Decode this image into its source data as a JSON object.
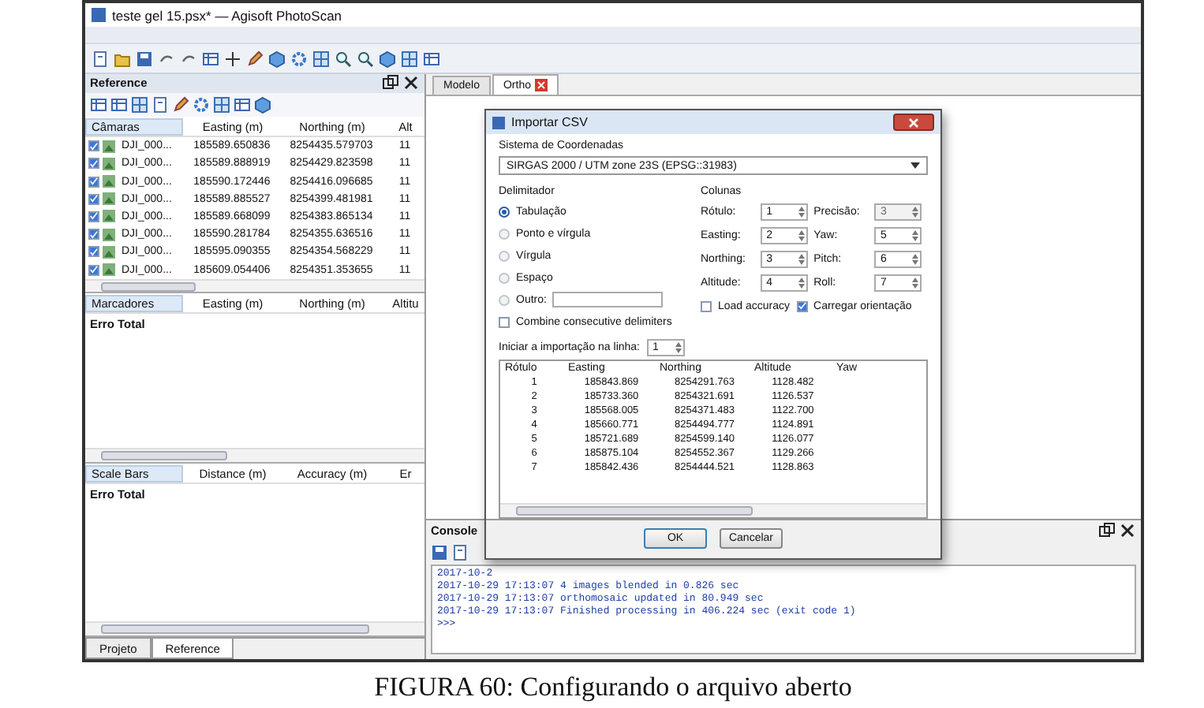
{
  "window": {
    "title": "teste gel 15.psx* — Agisoft PhotoScan"
  },
  "reference_panel": {
    "title": "Reference",
    "cameras": {
      "columns": [
        "Câmaras",
        "Easting (m)",
        "Northing (m)",
        "Alt"
      ],
      "rows": [
        {
          "checked": true,
          "label": "DJI_000...",
          "easting": "185589.650836",
          "northing": "8254435.579703",
          "altitude": "11"
        },
        {
          "checked": true,
          "label": "DJI_000...",
          "easting": "185589.888919",
          "northing": "8254429.823598",
          "altitude": "11"
        },
        {
          "checked": true,
          "label": "DJI_000...",
          "easting": "185590.172446",
          "northing": "8254416.096685",
          "altitude": "11"
        },
        {
          "checked": true,
          "label": "DJI_000...",
          "easting": "185589.885527",
          "northing": "8254399.481981",
          "altitude": "11"
        },
        {
          "checked": true,
          "label": "DJI_000...",
          "easting": "185589.668099",
          "northing": "8254383.865134",
          "altitude": "11"
        },
        {
          "checked": true,
          "label": "DJI_000...",
          "easting": "185590.281784",
          "northing": "8254355.636516",
          "altitude": "11"
        },
        {
          "checked": true,
          "label": "DJI_000...",
          "easting": "185595.090355",
          "northing": "8254354.568229",
          "altitude": "11"
        },
        {
          "checked": true,
          "label": "DJI_000...",
          "easting": "185609.054406",
          "northing": "8254351.353655",
          "altitude": "11"
        }
      ]
    },
    "markers": {
      "columns": [
        "Marcadores",
        "Easting (m)",
        "Northing (m)",
        "Altitu"
      ],
      "total": "Erro Total"
    },
    "scale_bars": {
      "columns": [
        "Scale Bars",
        "Distance (m)",
        "Accuracy (m)",
        "Er"
      ],
      "total": "Erro Total"
    },
    "tabs": [
      {
        "label": "Projeto",
        "selected": false
      },
      {
        "label": "Reference",
        "selected": true
      }
    ]
  },
  "view_tabs": [
    {
      "label": "Modelo",
      "selected": false
    },
    {
      "label": "Ortho",
      "selected": true
    }
  ],
  "console": {
    "title": "Console",
    "lines": [
      "2017-10-2",
      "2017-10-29 17:13:07 4 images blended in 0.826 sec",
      "2017-10-29 17:13:07 orthomosaic updated in 80.949 sec",
      "2017-10-29 17:13:07 Finished processing in 406.224 sec (exit code 1)"
    ],
    "prompt": ">>>"
  },
  "dialog": {
    "title": "Importar CSV",
    "crs_label": "Sistema de Coordenadas",
    "crs_value": "SIRGAS 2000 / UTM zone 23S (EPSG::31983)",
    "delimiter_label": "Delimitador",
    "delimiters": [
      {
        "kind": "option",
        "label": "Tabulação",
        "selected": true
      },
      {
        "kind": "option",
        "label": "Ponto e vírgula",
        "selected": false
      },
      {
        "kind": "option",
        "label": "Vírgula",
        "selected": false
      },
      {
        "kind": "option",
        "label": "Espaço",
        "selected": false
      },
      {
        "kind": "custom",
        "label": "Outro:",
        "selected": false
      }
    ],
    "combine": {
      "label": "Combine consecutive delimiters",
      "checked": false
    },
    "columns_label": "Colunas",
    "columns": [
      {
        "label": "Rótulo:",
        "value": "1",
        "disabled": false
      },
      {
        "label": "Precisão:",
        "value": "3",
        "disabled": true
      },
      {
        "label": "Easting:",
        "value": "2",
        "disabled": false
      },
      {
        "label": "Yaw:",
        "value": "5",
        "disabled": false
      },
      {
        "label": "Northing:",
        "value": "3",
        "disabled": false
      },
      {
        "label": "Pitch:",
        "value": "6",
        "disabled": false
      },
      {
        "label": "Altitude:",
        "value": "4",
        "disabled": false
      },
      {
        "label": "Roll:",
        "value": "7",
        "disabled": false
      }
    ],
    "options": [
      {
        "label": "Load accuracy",
        "checked": false
      },
      {
        "label": "Carregar orientação",
        "checked": true
      }
    ],
    "start_label": "Iniciar a importação na linha:",
    "start_value": "1",
    "preview": {
      "columns": [
        "Rótulo",
        "Easting",
        "Northing",
        "Altitude",
        "Yaw"
      ],
      "rows": [
        [
          "1",
          "185843.869",
          "8254291.763",
          "1128.482"
        ],
        [
          "2",
          "185733.360",
          "8254321.691",
          "1126.537"
        ],
        [
          "3",
          "185568.005",
          "8254371.483",
          "1122.700"
        ],
        [
          "4",
          "185660.771",
          "8254494.777",
          "1124.891"
        ],
        [
          "5",
          "185721.689",
          "8254599.140",
          "1126.077"
        ],
        [
          "6",
          "185875.104",
          "8254552.367",
          "1129.266"
        ],
        [
          "7",
          "185842.436",
          "8254444.521",
          "1128.863"
        ]
      ]
    },
    "buttons": [
      {
        "label": "OK",
        "kind": "default"
      },
      {
        "label": "Cancelar",
        "kind": "normal"
      }
    ]
  },
  "caption": "FIGURA 60: Configurando o arquivo aberto"
}
